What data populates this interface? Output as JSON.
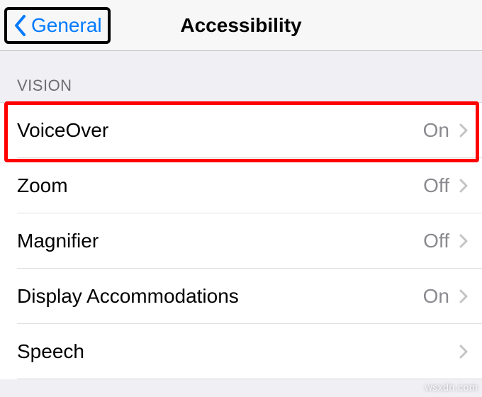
{
  "nav": {
    "back_label": "General",
    "title": "Accessibility"
  },
  "section": {
    "header": "VISION"
  },
  "rows": {
    "voiceover": {
      "label": "VoiceOver",
      "value": "On"
    },
    "zoom": {
      "label": "Zoom",
      "value": "Off"
    },
    "magnifier": {
      "label": "Magnifier",
      "value": "Off"
    },
    "display": {
      "label": "Display Accommodations",
      "value": "On"
    },
    "speech": {
      "label": "Speech",
      "value": ""
    }
  },
  "watermark": "wsxdn.com",
  "colors": {
    "tint": "#007aff",
    "highlight": "#ff0000",
    "background": "#efeff4",
    "secondary_text": "#8a8a8f"
  }
}
